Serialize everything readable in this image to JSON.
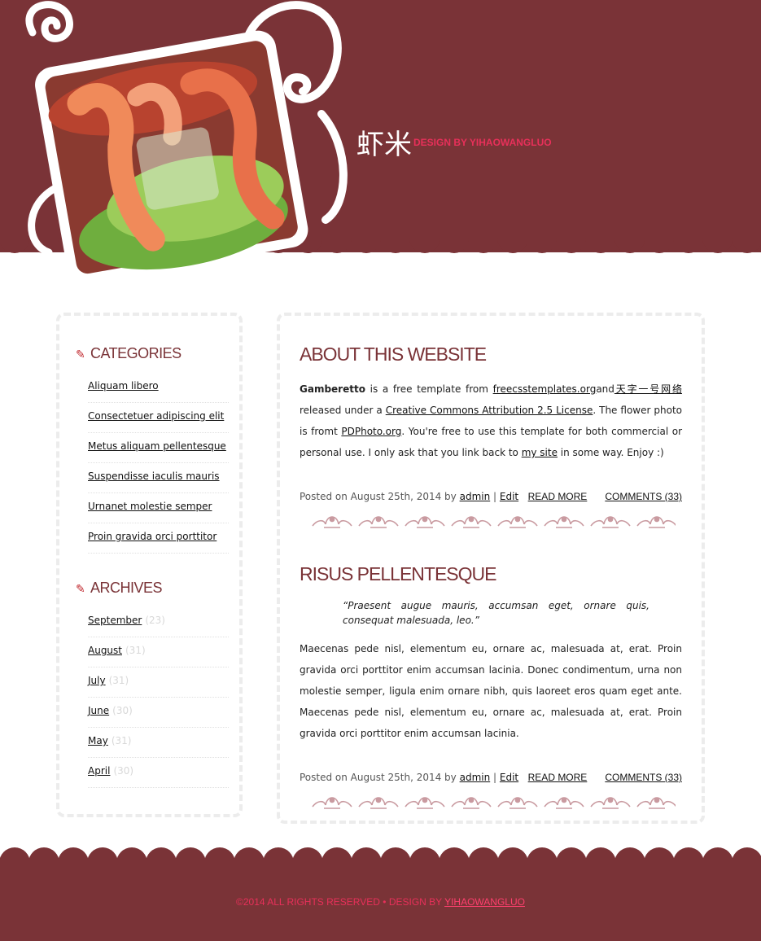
{
  "site": {
    "title": "虾米",
    "byline": "DESIGN BY YIHAOWANGLUO"
  },
  "colors": {
    "brand": "#7a3337",
    "accent": "#e8305a"
  },
  "sidebar": {
    "categories": {
      "heading": "CATEGORIES",
      "items": [
        {
          "label": "Aliquam libero"
        },
        {
          "label": "Consectetuer adipiscing elit"
        },
        {
          "label": "Metus aliquam pellentesque"
        },
        {
          "label": "Suspendisse iaculis mauris"
        },
        {
          "label": "Urnanet molestie semper"
        },
        {
          "label": "Proin gravida orci porttitor"
        }
      ]
    },
    "archives": {
      "heading": "ARCHIVES",
      "items": [
        {
          "label": "September",
          "count": "(23)"
        },
        {
          "label": "August",
          "count": "(31)"
        },
        {
          "label": "July",
          "count": "(31)"
        },
        {
          "label": "June",
          "count": "(30)"
        },
        {
          "label": "May",
          "count": "(31)"
        },
        {
          "label": "April",
          "count": "(30)"
        }
      ]
    }
  },
  "posts": [
    {
      "title": "ABOUT THIS WEBSITE",
      "body": {
        "strong": "Gamberetto",
        "t1": " is a free template from ",
        "link1": "freecsstemplates.org",
        "t2": "and",
        "link2": "天字一号网络",
        "t3": " released under a ",
        "link3": "Creative Commons Attribution 2.5 License",
        "t4": ". The flower photo is fromt ",
        "link4": "PDPhoto.org",
        "t5": ". You're free to use this template for both commercial or personal use. I only ask that you link back to ",
        "link5": "my site",
        "t6": " in some way. Enjoy :)"
      },
      "meta": {
        "posted": "Posted on August 25th, 2014 by ",
        "author": "admin",
        "sep": " | ",
        "edit": "Edit",
        "read_more": "READ MORE",
        "comments": "COMMENTS (33)"
      }
    },
    {
      "title": "RISUS PELLENTESQUE",
      "quote": "“Praesent augue mauris, accumsan eget, ornare quis, consequat malesuada, leo.”",
      "body": "Maecenas pede nisl, elementum eu, ornare ac, malesuada at, erat. Proin gravida orci porttitor enim accumsan lacinia. Donec condimentum, urna non molestie semper, ligula enim ornare nibh, quis laoreet eros quam eget ante. Maecenas pede nisl, elementum eu, ornare ac, malesuada at, erat. Proin gravida orci porttitor enim accumsan lacinia.",
      "meta": {
        "posted": "Posted on August 25th, 2014 by ",
        "author": "admin",
        "sep": " | ",
        "edit": "Edit",
        "read_more": "READ MORE",
        "comments": "COMMENTS (33)"
      }
    }
  ],
  "footer": {
    "copyright": "©2014 ALL RIGHTS RESERVED",
    "dot": " • ",
    "design": "DESIGN BY ",
    "design_link": "YIHAOWANGLUO"
  }
}
